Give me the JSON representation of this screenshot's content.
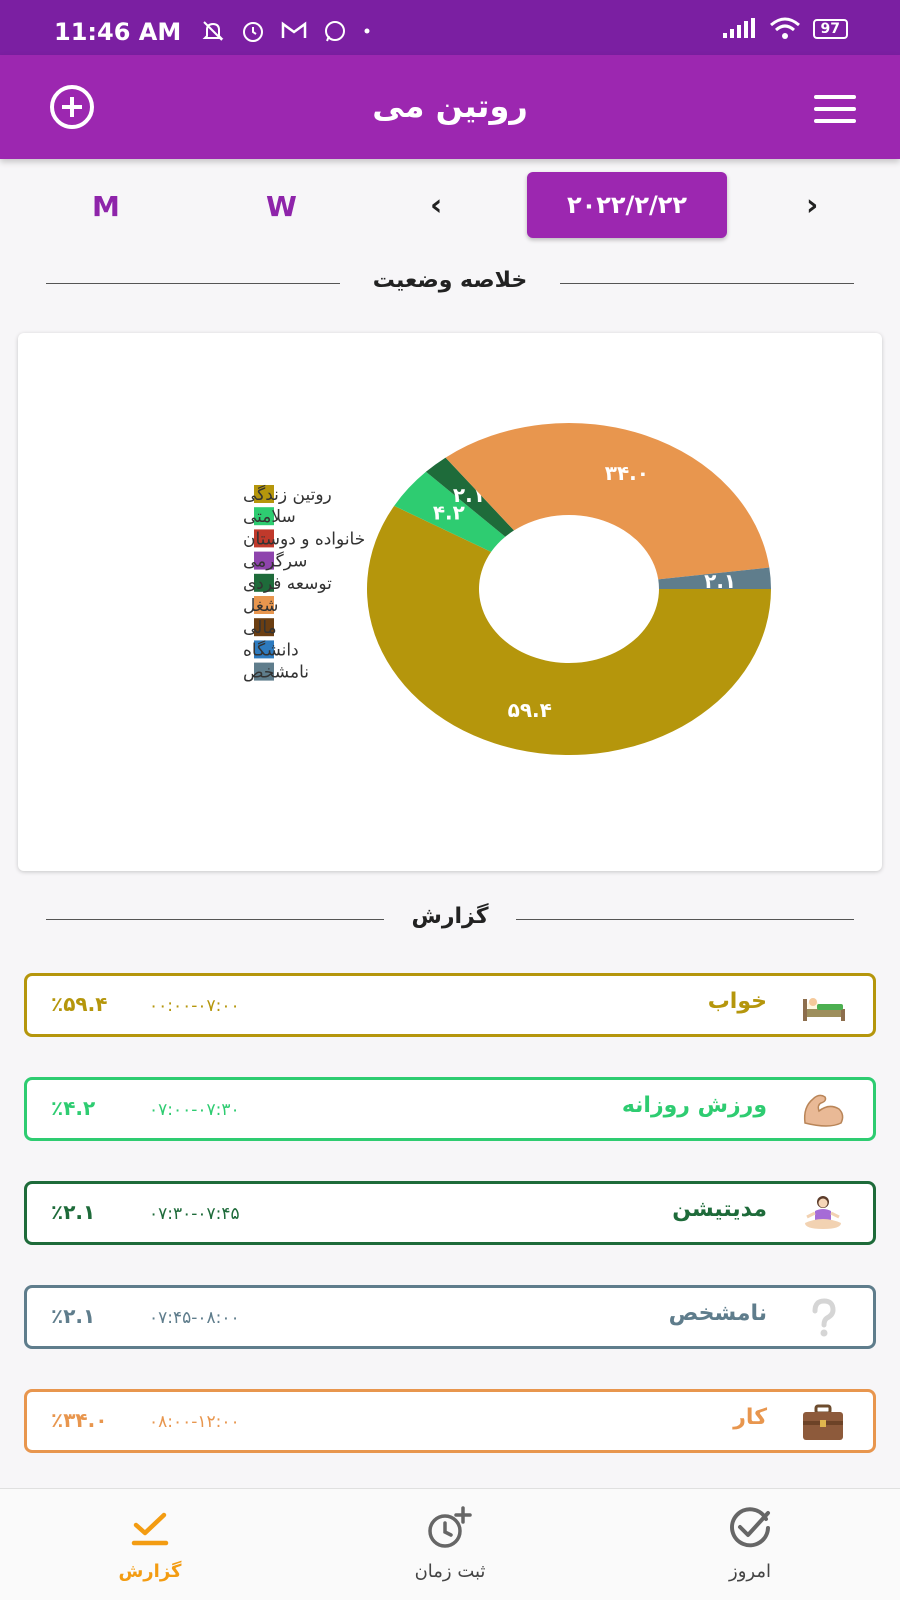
{
  "status": {
    "time": "11:46 AM",
    "battery": "97"
  },
  "app": {
    "title": "روتین می"
  },
  "date_nav": {
    "month_label": "M",
    "week_label": "W",
    "date": "۲۰۲۲/۲/۲۲"
  },
  "summary_title": "خلاصه وضعیت",
  "report_title": "گزارش",
  "colors": {
    "primary": "#9c27b0",
    "primary_dark": "#7b1fa2",
    "accent_orange": "#f39c12"
  },
  "chart_data": {
    "type": "pie",
    "legend": [
      "روتین زندگی",
      "سلامتی",
      "خانواده و دوستان",
      "سرگرمی",
      "توسعه فردی",
      "شغل",
      "مالی",
      "دانشگاه",
      "نامشخص"
    ],
    "legend_colors": [
      "#b5960c",
      "#2ecc71",
      "#c0392b",
      "#8e44ad",
      "#1e6b3a",
      "#e8964e",
      "#6b3e12",
      "#2e7bbf",
      "#5f7d8c"
    ],
    "slices": [
      {
        "category": "روتین زندگی",
        "value": 59.4,
        "label": "۵۹.۴",
        "color": "#b5960c"
      },
      {
        "category": "سلامتی",
        "value": 4.2,
        "label": "۴.۲",
        "color": "#2ecc71"
      },
      {
        "category": "توسعه فردی",
        "value": 2.1,
        "label": "۲.۱",
        "color": "#1e6b3a"
      },
      {
        "category": "شغل",
        "value": 34.0,
        "label": "۳۴.۰",
        "color": "#e8964e"
      },
      {
        "category": "نامشخص",
        "value": 2.1,
        "label": "۲.۱",
        "color": "#5f7d8c"
      }
    ],
    "legend_placement": "left"
  },
  "report_items": [
    {
      "title": "خواب",
      "time": "۰۰:۰۰-۰۷:۰۰",
      "percent": "٪۵۹.۴",
      "color": "#b5960c",
      "icon": "bed-icon"
    },
    {
      "title": "ورزش روزانه",
      "time": "۰۷:۰۰-۰۷:۳۰",
      "percent": "٪۴.۲",
      "color": "#2ecc71",
      "icon": "flexed-biceps-icon"
    },
    {
      "title": "مدیتیشن",
      "time": "۰۷:۳۰-۰۷:۴۵",
      "percent": "٪۲.۱",
      "color": "#1e6b3a",
      "icon": "meditation-icon"
    },
    {
      "title": "نامشخص",
      "time": "۰۷:۴۵-۰۸:۰۰",
      "percent": "٪۲.۱",
      "color": "#5f7d8c",
      "icon": "question-mark-icon"
    },
    {
      "title": "کار",
      "time": "۰۸:۰۰-۱۲:۰۰",
      "percent": "٪۳۴.۰",
      "color": "#e8964e",
      "icon": "briefcase-icon"
    }
  ],
  "bottom_nav": {
    "report": "گزارش",
    "log_time": "ثبت زمان",
    "today": "امروز"
  }
}
